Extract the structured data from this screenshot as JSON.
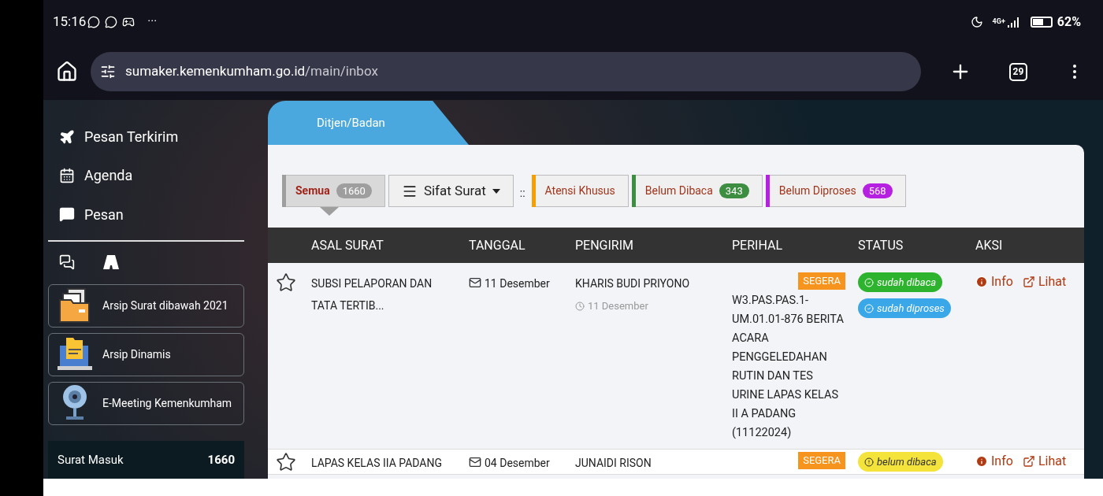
{
  "status_bar": {
    "time": "15:16",
    "more": "···",
    "network": "4G+",
    "battery": "62%"
  },
  "browser": {
    "url_host": "sumaker.kemenkumham.go.id",
    "url_path": "/main/inbox",
    "tab_count": "29"
  },
  "sidebar": {
    "items": [
      {
        "kind": "plane",
        "label": "Pesan Terkirim"
      },
      {
        "kind": "calendar",
        "label": "Agenda"
      },
      {
        "kind": "chat",
        "label": "Pesan"
      }
    ],
    "links": [
      {
        "kind": "archive",
        "label": "Arsip Surat dibawah 2021"
      },
      {
        "kind": "dynamic",
        "label": "Arsip Dinamis"
      },
      {
        "kind": "meeting",
        "label": "E-Meeting Kemenkumham"
      }
    ],
    "counter": {
      "label": "Surat Masuk",
      "count": "1660"
    }
  },
  "tab": {
    "label": "Ditjen/Badan"
  },
  "filters": [
    {
      "label": "Semua",
      "count": "1660",
      "color": "#9e9e9e",
      "selected": true
    },
    {
      "kind": "dropdown",
      "label": "Sifat Surat"
    },
    {
      "kind": "separator",
      "label": "::"
    },
    {
      "label": "Atensi Khusus",
      "color": "#f5a000",
      "selected": false
    },
    {
      "label": "Belum Dibaca",
      "count": "343",
      "color": "#3e8e41",
      "selected": false
    },
    {
      "label": "Belum Diproses",
      "count": "568",
      "color": "#b620e0",
      "selected": false
    }
  ],
  "table": {
    "columns": [
      "ASAL SURAT",
      "TANGGAL",
      "PENGIRIM",
      "PERIHAL",
      "STATUS",
      "AKSI"
    ],
    "rows": [
      {
        "starred": false,
        "origin": "SUBSI PELAPORAN DAN TATA TERTIB...",
        "date": "11 Desember",
        "sender": "KHARIS BUDI PRIYONO",
        "sent": "11 Desember",
        "priority": "SEGERA",
        "subject": "W3.PAS.PAS.1-UM.01.01-876 BERITA ACARA PENGGELEDAHAN RUTIN DAN TES URINE LAPAS KELAS II A PADANG (11122024)",
        "statuses": [
          {
            "kind": "read",
            "label": "sudah dibaca"
          },
          {
            "kind": "processed",
            "label": "sudah diproses"
          }
        ],
        "actions": [
          "Info",
          "Lihat"
        ]
      },
      {
        "starred": false,
        "origin": "LAPAS KELAS IIA PADANG",
        "date": "04 Desember",
        "sender": "JUNAIDI RISON",
        "priority": "SEGERA",
        "statuses": [
          {
            "kind": "unread",
            "label": "belum dibaca"
          }
        ],
        "actions": [
          "Info",
          "Lihat"
        ]
      }
    ]
  }
}
